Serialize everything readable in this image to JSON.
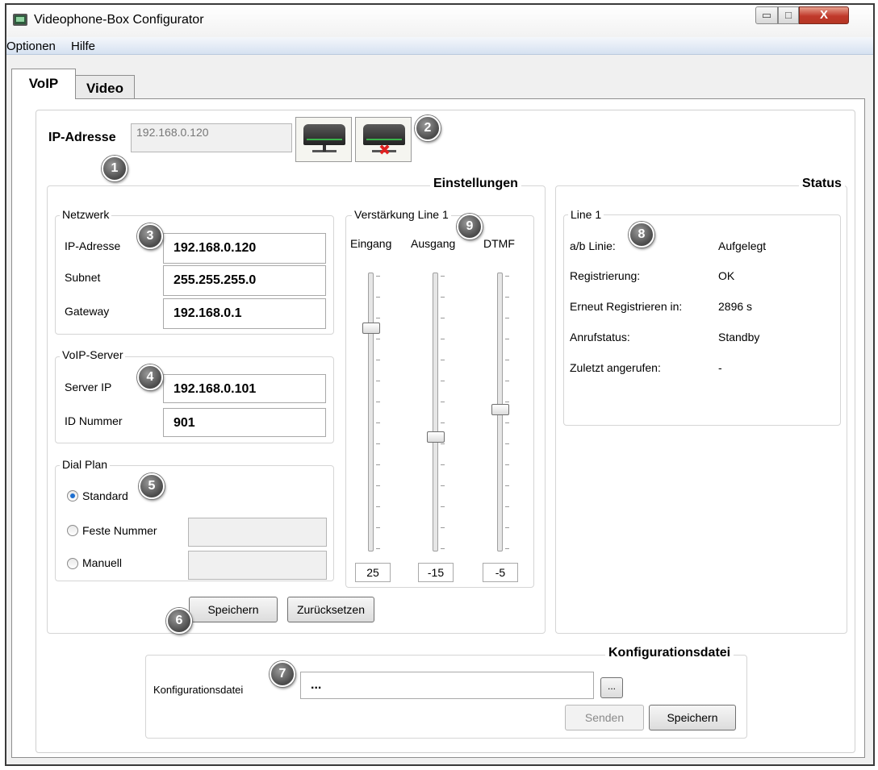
{
  "window": {
    "title": "Videophone-Box Configurator",
    "controls": {
      "minimize": "▭",
      "maximize": "□",
      "close": "X"
    }
  },
  "menu": [
    "Optionen",
    "Hilfe"
  ],
  "tabs": [
    "VoIP",
    "Video"
  ],
  "top": {
    "ip_label": "IP-Adresse",
    "ip_value": "192.168.0.120"
  },
  "badges": [
    "1",
    "2",
    "3",
    "4",
    "5",
    "6",
    "7",
    "8",
    "9"
  ],
  "einstellungen": {
    "title": "Einstellungen",
    "netzwerk": {
      "title": "Netzwerk",
      "ip_label": "IP-Adresse",
      "ip_value": "192.168.0.120",
      "subnet_label": "Subnet",
      "subnet_value": "255.255.255.0",
      "gateway_label": "Gateway",
      "gateway_value": "192.168.0.1"
    },
    "voip_server": {
      "title": "VoIP-Server",
      "server_label": "Server IP",
      "server_value": "192.168.0.101",
      "id_label": "ID Nummer",
      "id_value": "901"
    },
    "dial_plan": {
      "title": "Dial Plan",
      "options": [
        "Standard",
        "Feste Nummer",
        "Manuell"
      ],
      "selected": "Standard"
    },
    "gain": {
      "title": "Verstärkung Line 1",
      "sliders": [
        {
          "label": "Eingang",
          "value": "25",
          "level": 0.82
        },
        {
          "label": "Ausgang",
          "value": "-15",
          "level": 0.42
        },
        {
          "label": "DTMF",
          "value": "-5",
          "level": 0.52
        }
      ]
    },
    "save_button": "Speichern",
    "reset_button": "Zurücksetzen"
  },
  "status": {
    "title": "Status",
    "line_title": "Line 1",
    "rows": [
      {
        "label": "a/b Linie:",
        "value": "Aufgelegt"
      },
      {
        "label": "Registrierung:",
        "value": "OK"
      },
      {
        "label": "Erneut Registrieren in:",
        "value": "2896 s"
      },
      {
        "label": "Anrufstatus:",
        "value": "Standby"
      },
      {
        "label": "Zuletzt angerufen:",
        "value": "-"
      }
    ]
  },
  "config_file": {
    "title": "Konfigurationsdatei",
    "label": "Konfigurationsdatei",
    "value": "...",
    "browse_label": "...",
    "send_button": "Senden",
    "save_button": "Speichern"
  },
  "colors": {
    "accent": "#1e6fd0",
    "close_button": "#c0392b",
    "menubar": "#d6e2f1"
  }
}
